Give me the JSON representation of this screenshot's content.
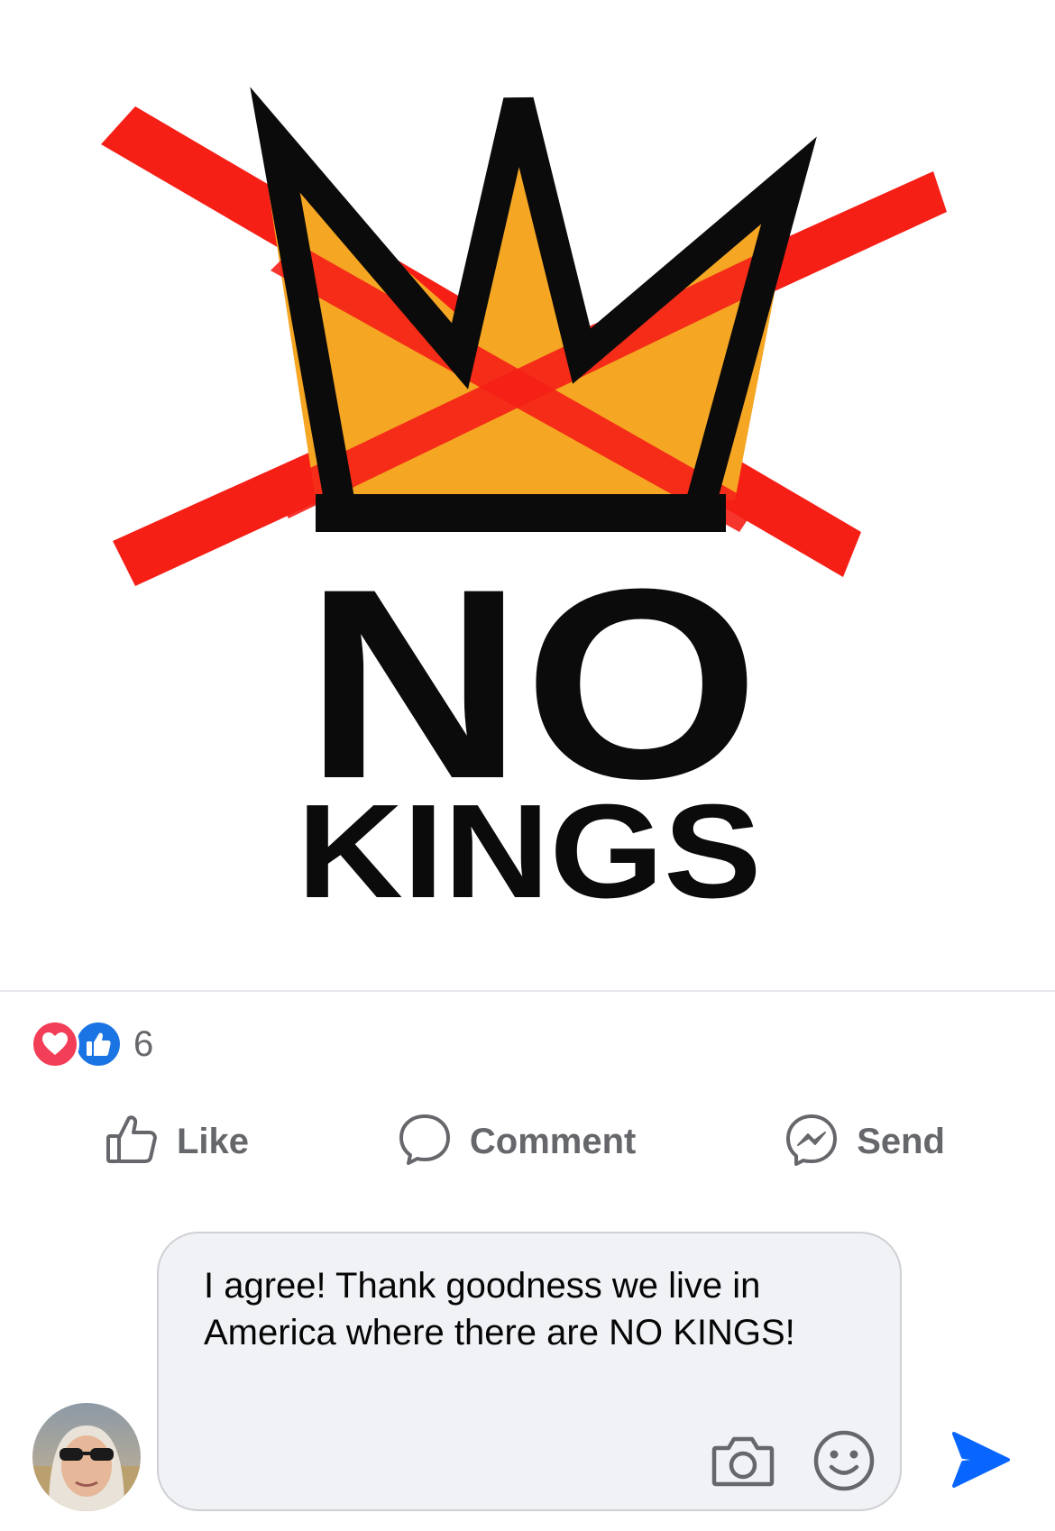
{
  "post": {
    "image": {
      "text_line1": "NO",
      "text_line2": "KINGS",
      "colors": {
        "cross": "#f51f16",
        "crown_fill": "#f5a623",
        "crown_outline": "#0b0b0b",
        "text": "#0b0b0b"
      }
    },
    "reactions": {
      "icons": [
        "heart-icon",
        "thumbs-up-icon"
      ],
      "count": "6",
      "colors": {
        "love": "#f33e58",
        "like": "#1b74e4"
      }
    },
    "actions": {
      "like_label": "Like",
      "comment_label": "Comment",
      "send_label": "Send"
    }
  },
  "composer": {
    "text": "I agree! Thank goodness we live in America where there are NO KINGS!",
    "icons": [
      "camera-icon",
      "emoji-icon",
      "send-icon"
    ],
    "send_color": "#0866ff"
  }
}
